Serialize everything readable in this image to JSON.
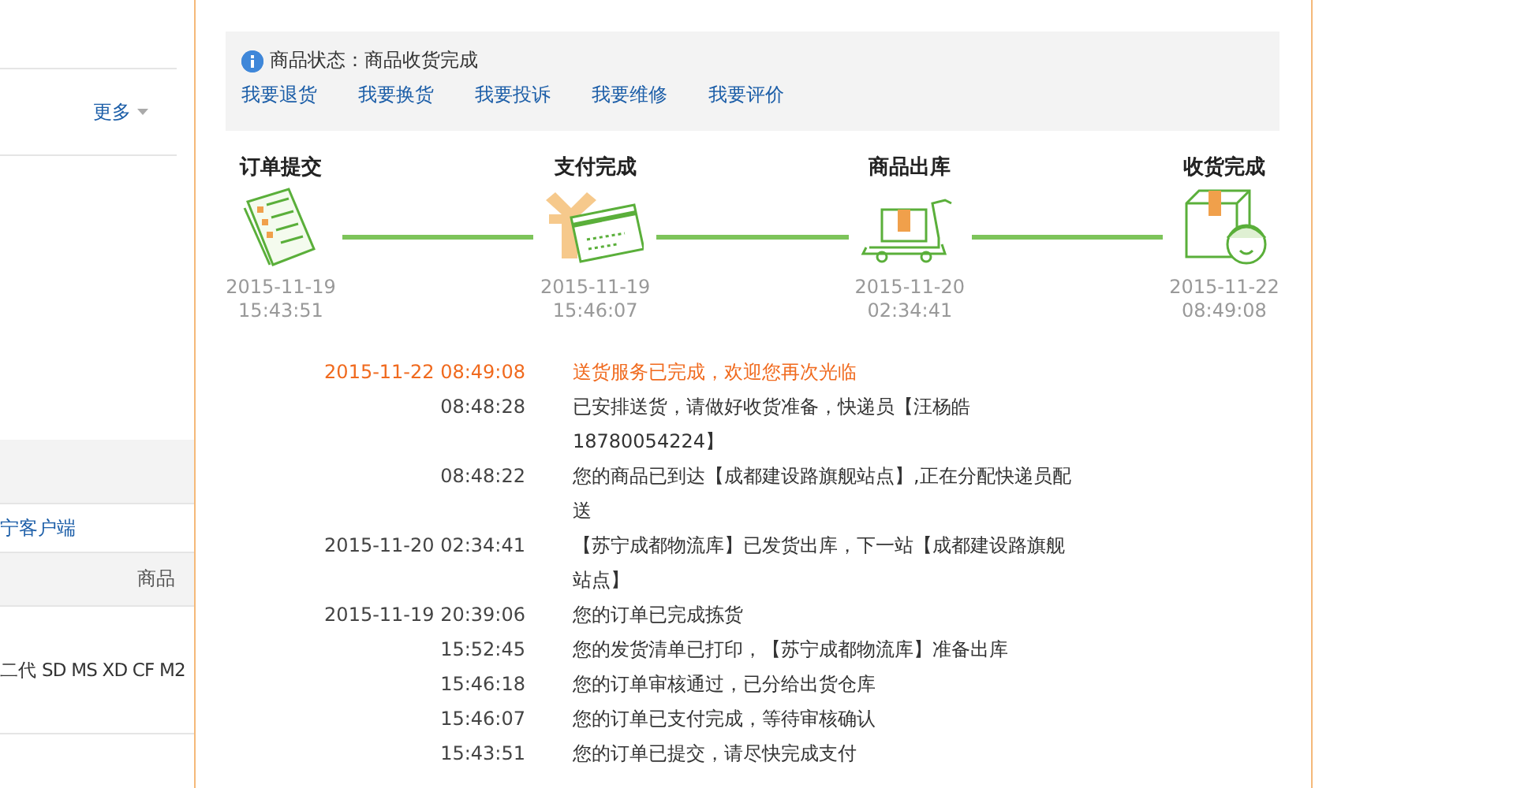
{
  "sidebar": {
    "more_link": "更多",
    "banner_link": "宁客户端",
    "table": {
      "columns": [
        "商品"
      ],
      "rows": [
        [
          "二代 SD MS XD CF M2"
        ]
      ]
    }
  },
  "status": {
    "label": "商品状态：",
    "value": "商品收货完成",
    "actions": [
      "我要退货",
      "我要换货",
      "我要投诉",
      "我要维修",
      "我要评价"
    ]
  },
  "steps": [
    {
      "kind": "order",
      "title": "订单提交",
      "date": "2015-11-19",
      "time": "15:43:51"
    },
    {
      "kind": "payment",
      "title": "支付完成",
      "date": "2015-11-19",
      "time": "15:46:07"
    },
    {
      "kind": "shipping",
      "title": "商品出库",
      "date": "2015-11-20",
      "time": "02:34:41"
    },
    {
      "kind": "received",
      "title": "收货完成",
      "date": "2015-11-22",
      "time": "08:49:08"
    }
  ],
  "log": [
    {
      "time": "2015-11-22 08:49:08",
      "message": "送货服务已完成，欢迎您再次光临",
      "highlight": true
    },
    {
      "time": "08:48:28",
      "message": "已安排送货，请做好收货准备，快递员【汪杨皓 18780054224】",
      "highlight": false
    },
    {
      "time": "08:48:22",
      "message": "您的商品已到达【成都建设路旗舰站点】,正在分配快递员配送",
      "highlight": false
    },
    {
      "time": "2015-11-20 02:34:41",
      "message": "【苏宁成都物流库】已发货出库，下一站【成都建设路旗舰站点】",
      "highlight": false
    },
    {
      "time": "2015-11-19 20:39:06",
      "message": "您的订单已完成拣货",
      "highlight": false
    },
    {
      "time": "15:52:45",
      "message": "您的发货清单已打印，【苏宁成都物流库】准备出库",
      "highlight": false
    },
    {
      "time": "15:46:18",
      "message": "您的订单审核通过，已分给出货仓库",
      "highlight": false
    },
    {
      "time": "15:46:07",
      "message": "您的订单已支付完成，等待审核确认",
      "highlight": false
    },
    {
      "time": "15:43:51",
      "message": "您的订单已提交，请尽快完成支付",
      "highlight": false
    }
  ]
}
